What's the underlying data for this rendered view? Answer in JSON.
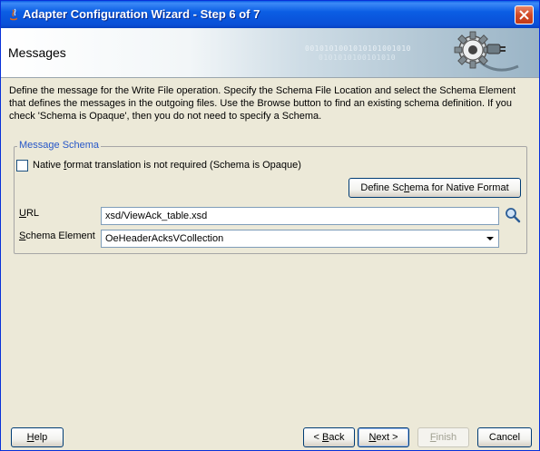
{
  "window": {
    "title": "Adapter Configuration Wizard - Step 6 of 7"
  },
  "banner": {
    "title": "Messages",
    "binary_line1": "0010101001010101001010",
    "binary_line2": "0101010100101010"
  },
  "description": "Define the message for the Write File operation.  Specify the Schema File Location and select the Schema Element that defines the messages in the outgoing files. Use the Browse button to find an existing schema definition. If you check 'Schema is Opaque', then you do not need to specify a Schema.",
  "message_schema": {
    "group_title": "Message Schema",
    "opaque_checkbox": {
      "pre": "Native ",
      "mnemonic": "f",
      "post": "ormat translation is not required (Schema is Opaque)",
      "checked": false
    },
    "define_button": {
      "pre": "Define Sc",
      "mnemonic": "h",
      "post": "ema for Native Format"
    },
    "url": {
      "label_mnemonic": "U",
      "label_rest": "RL",
      "value": "xsd/ViewAck_table.xsd"
    },
    "schema_element": {
      "label_pre": "",
      "label_mnemonic": "S",
      "label_rest": "chema Element",
      "value": "OeHeaderAcksVCollection"
    }
  },
  "buttons": {
    "help": {
      "mnemonic": "H",
      "rest": "elp"
    },
    "back": {
      "pre": "< ",
      "mnemonic": "B",
      "rest": "ack"
    },
    "next": {
      "mnemonic": "N",
      "rest": "ext >"
    },
    "finish": {
      "mnemonic": "F",
      "rest": "inish"
    },
    "cancel": {
      "label": "Cancel"
    }
  },
  "colors": {
    "titlebar": "#0a5fe6",
    "group_title": "#2757c8",
    "dialog_bg": "#ece9d8"
  }
}
